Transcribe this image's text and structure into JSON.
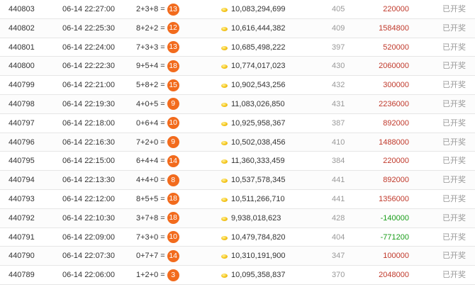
{
  "rows": [
    {
      "issue": "440803",
      "time": "06-14 22:27:00",
      "formula": "2+3+8 =",
      "result": "13",
      "pool": "10,083,294,699",
      "count": "405",
      "win": "220000",
      "win_color": "#c0392b",
      "status": "已开奖"
    },
    {
      "issue": "440802",
      "time": "06-14 22:25:30",
      "formula": "8+2+2 =",
      "result": "12",
      "pool": "10,616,444,382",
      "count": "409",
      "win": "1584800",
      "win_color": "#c0392b",
      "status": "已开奖"
    },
    {
      "issue": "440801",
      "time": "06-14 22:24:00",
      "formula": "7+3+3 =",
      "result": "13",
      "pool": "10,685,498,222",
      "count": "397",
      "win": "520000",
      "win_color": "#c0392b",
      "status": "已开奖"
    },
    {
      "issue": "440800",
      "time": "06-14 22:22:30",
      "formula": "9+5+4 =",
      "result": "18",
      "pool": "10,774,017,023",
      "count": "430",
      "win": "2060000",
      "win_color": "#c0392b",
      "status": "已开奖"
    },
    {
      "issue": "440799",
      "time": "06-14 22:21:00",
      "formula": "5+8+2 =",
      "result": "15",
      "pool": "10,902,543,256",
      "count": "432",
      "win": "300000",
      "win_color": "#c0392b",
      "status": "已开奖"
    },
    {
      "issue": "440798",
      "time": "06-14 22:19:30",
      "formula": "4+0+5 =",
      "result": "9",
      "pool": "11,083,026,850",
      "count": "431",
      "win": "2236000",
      "win_color": "#c0392b",
      "status": "已开奖"
    },
    {
      "issue": "440797",
      "time": "06-14 22:18:00",
      "formula": "0+6+4 =",
      "result": "10",
      "pool": "10,925,958,367",
      "count": "387",
      "win": "892000",
      "win_color": "#c0392b",
      "status": "已开奖"
    },
    {
      "issue": "440796",
      "time": "06-14 22:16:30",
      "formula": "7+2+0 =",
      "result": "9",
      "pool": "10,502,038,456",
      "count": "410",
      "win": "1488000",
      "win_color": "#c0392b",
      "status": "已开奖"
    },
    {
      "issue": "440795",
      "time": "06-14 22:15:00",
      "formula": "6+4+4 =",
      "result": "14",
      "pool": "11,360,333,459",
      "count": "384",
      "win": "220000",
      "win_color": "#c0392b",
      "status": "已开奖"
    },
    {
      "issue": "440794",
      "time": "06-14 22:13:30",
      "formula": "4+4+0 =",
      "result": "8",
      "pool": "10,537,578,345",
      "count": "441",
      "win": "892000",
      "win_color": "#c0392b",
      "status": "已开奖"
    },
    {
      "issue": "440793",
      "time": "06-14 22:12:00",
      "formula": "8+5+5 =",
      "result": "18",
      "pool": "10,511,266,710",
      "count": "441",
      "win": "1356000",
      "win_color": "#c0392b",
      "status": "已开奖"
    },
    {
      "issue": "440792",
      "time": "06-14 22:10:30",
      "formula": "3+7+8 =",
      "result": "18",
      "pool": "9,938,018,623",
      "count": "428",
      "win": "-140000",
      "win_color": "#1a9d1a",
      "status": "已开奖"
    },
    {
      "issue": "440791",
      "time": "06-14 22:09:00",
      "formula": "7+3+0 =",
      "result": "10",
      "pool": "10,479,784,820",
      "count": "404",
      "win": "-771200",
      "win_color": "#1a9d1a",
      "status": "已开奖"
    },
    {
      "issue": "440790",
      "time": "06-14 22:07:30",
      "formula": "0+7+7 =",
      "result": "14",
      "pool": "10,310,191,900",
      "count": "347",
      "win": "100000",
      "win_color": "#c0392b",
      "status": "已开奖"
    },
    {
      "issue": "440789",
      "time": "06-14 22:06:00",
      "formula": "1+2+0 =",
      "result": "3",
      "pool": "10,095,358,837",
      "count": "370",
      "win": "2048000",
      "win_color": "#c0392b",
      "status": "已开奖"
    }
  ],
  "colors": {
    "result_ball": "#f26b1d",
    "coin_icon": "gold-coin-icon"
  }
}
